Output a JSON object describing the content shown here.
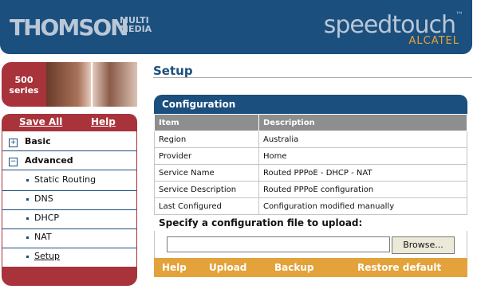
{
  "header": {
    "brand": "THOMSON",
    "brand_sub_line1": "MULTI",
    "brand_sub_line2": "MEDIA",
    "product": "speedtouch",
    "product_tm": "™",
    "maker": "ALCATEL"
  },
  "badge": {
    "number": "500",
    "word": "series"
  },
  "sidebar": {
    "save_all": "Save All",
    "help": "Help",
    "items": [
      {
        "icon": "plus-box-icon",
        "symbol": "+",
        "label": "Basic"
      },
      {
        "icon": "minus-box-icon",
        "symbol": "−",
        "label": "Advanced"
      }
    ],
    "subitems": [
      "Static Routing",
      "DNS",
      "DHCP",
      "NAT",
      "Setup"
    ]
  },
  "main": {
    "title": "Setup",
    "panel_title": "Configuration",
    "columns": [
      "Item",
      "Description"
    ],
    "rows": [
      [
        "Region",
        "Australia"
      ],
      [
        "Provider",
        "Home"
      ],
      [
        "Service Name",
        "Routed PPPoE - DHCP - NAT"
      ],
      [
        "Service Description",
        "Routed PPPoE configuration"
      ],
      [
        "Last Configured",
        "Configuration modified manually"
      ]
    ],
    "upload_label": "Specify a configuration file to upload:",
    "file_value": "",
    "browse": "Browse...",
    "actions": [
      "Help",
      "Upload",
      "Backup",
      "Restore default"
    ]
  },
  "colors": {
    "header_blue": "#1b4f7e",
    "sidebar_red": "#a8333b",
    "action_orange": "#e3a23a",
    "table_header_gray": "#8e8e8e"
  }
}
